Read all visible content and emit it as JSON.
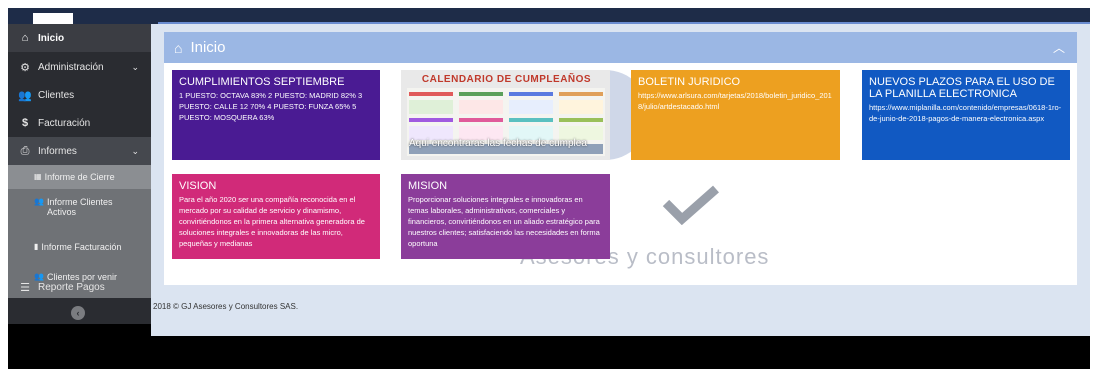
{
  "sidebar": {
    "items": [
      {
        "label": "Inicio",
        "icon": "home-icon"
      },
      {
        "label": "Administración",
        "icon": "cogs-icon"
      },
      {
        "label": "Clientes",
        "icon": "users-icon"
      },
      {
        "label": "Facturación",
        "icon": "dollar-icon"
      },
      {
        "label": "Informes",
        "icon": "print-icon"
      }
    ],
    "submenu": [
      {
        "label": "Informe de Cierre",
        "icon": "table-icon"
      },
      {
        "label": "Informe Clientes Activos",
        "icon": "users-icon"
      },
      {
        "label": "Informe Facturación",
        "icon": "bar-chart-icon"
      },
      {
        "label": "Clientes por venir",
        "icon": "users-icon"
      }
    ],
    "reporte": {
      "label": "Reporte Pagos",
      "icon": "list-alt-icon"
    }
  },
  "header": {
    "title": "Inicio"
  },
  "tiles": {
    "cumplimientos": {
      "title": "CUMPLIMIENTOS SEPTIEMBRE",
      "body": "1 PUESTO: OCTAVA 83% 2 PUESTO: MADRID 82% 3 PUESTO: CALLE 12 70% 4 PUESTO: FUNZA 65% 5 PUESTO: MOSQUERA 63%"
    },
    "image": {
      "title": "CALENDARIO DE CUMPLEAÑOS",
      "caption": "Aqui encontraras las fechas de cumplea"
    },
    "boletin": {
      "title": "BOLETIN JURIDICO",
      "body": "https://www.arlsura.com/tarjetas/2018/boletin_juridico_2018/julio/artdestacado.html"
    },
    "nuevos": {
      "title": "NUEVOS PLAZOS PARA EL USO DE LA PLANILLA ELECTRONICA",
      "body": "https://www.miplanilla.com/contenido/empresas/0618-1ro-de-junio-de-2018-pagos-de-manera-electronica.aspx"
    },
    "vision": {
      "title": "VISION",
      "body": "Para el año 2020 ser una compañía reconocida en el mercado por su calidad de servicio y dinamismo, convirtiéndonos en la primera alternativa generadora de soluciones integrales e innovadoras de las micro, pequeñas y medianas"
    },
    "mision": {
      "title": "MISION",
      "body": "Proporcionar soluciones integrales e innovadoras en temas laborales, administrativos, comerciales y financieros, convirtiéndonos en un aliado estratégico para nuestros clientes; satisfaciendo las necesidades en forma oportuna"
    }
  },
  "watermark": {
    "text": "Asesores y consultores"
  },
  "footer": {
    "text": "2018 © GJ Asesores y Consultores SAS."
  },
  "colors": {
    "sidebar": "#2a2c31",
    "header": "#9bb7e4",
    "cumplimientos": "#4a1b93",
    "boletin": "#eda020",
    "nuevos": "#1159c2",
    "vision": "#d12a79",
    "mision": "#8b3d9a"
  }
}
